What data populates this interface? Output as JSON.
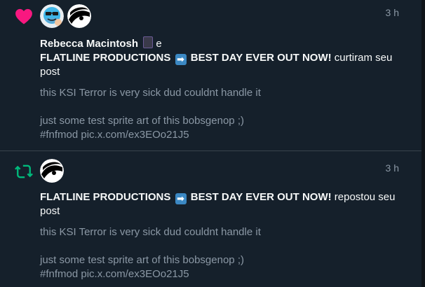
{
  "colors": {
    "background": "#15202b",
    "like": "#f91880",
    "repost": "#00ba7c",
    "text_primary": "#f7f9f9",
    "text_secondary": "#8b98a5",
    "divider": "#38444d"
  },
  "notifications": [
    {
      "type_icon": "heart-icon",
      "time": "3 h",
      "actor1_name": "Rebecca Macintosh",
      "actor1_emoji": "device-emoji",
      "conjunction": "e",
      "actor2_name": "FLATLINE PRODUCTIONS",
      "actor2_emoji": "right-arrow-emoji",
      "actor2_suffix": "BEST DAY EVER OUT NOW!",
      "action": "curtiram seu post",
      "post_line1": "this KSI Terror is very sick dud couldnt handle it",
      "post_line2": "just some test sprite art of this bobsgenop ;)",
      "post_line3": "#fnfmod pic.x.com/ex3EOo21J5"
    },
    {
      "type_icon": "repost-icon",
      "time": "3 h",
      "actor2_name": "FLATLINE PRODUCTIONS",
      "actor2_emoji": "right-arrow-emoji",
      "actor2_suffix": "BEST DAY EVER OUT NOW!",
      "action": "repostou seu post",
      "post_line1": "this KSI Terror is very sick dud couldnt handle it",
      "post_line2": "just some test sprite art of this bobsgenop ;)",
      "post_line3": "#fnfmod pic.x.com/ex3EOo21J5"
    }
  ]
}
